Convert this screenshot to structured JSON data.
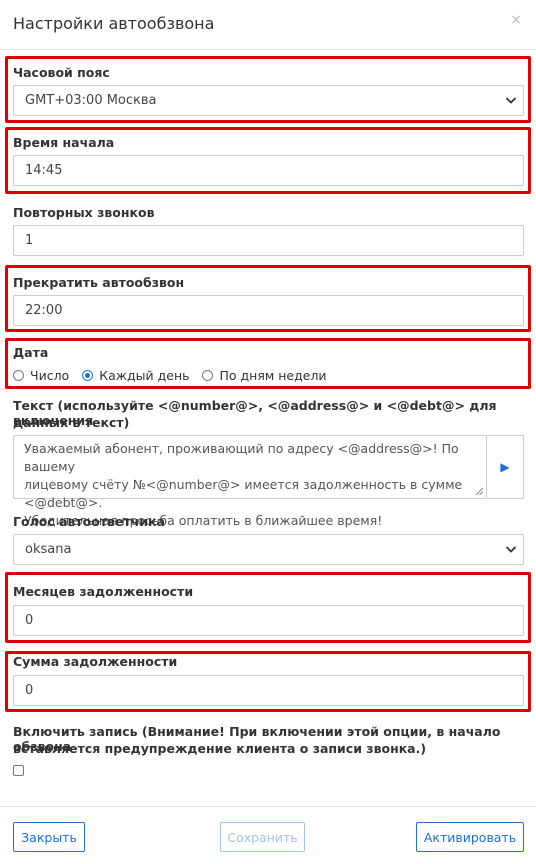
{
  "dialog": {
    "title": "Настройки автообзвона",
    "close": "×"
  },
  "timezone": {
    "label": "Часовой пояс",
    "value": "GMT+03:00 Москва"
  },
  "start_time": {
    "label": "Время начала",
    "value": "14:45"
  },
  "repeat_calls": {
    "label": "Повторных звонков",
    "value": "1"
  },
  "stop_time": {
    "label": "Прекратить автообзвон",
    "value": "22:00"
  },
  "date": {
    "label": "Дата",
    "options": [
      "Число",
      "Каждый день",
      "По дням недели"
    ],
    "selected": "Каждый день"
  },
  "text": {
    "label_line1": "Текст (используйте <@number@>, <@address@> и <@debt@> для включения",
    "label_line2": "данных в текст)",
    "value_line1": "Уважаемый абонент, проживающий по адресу <@address@>!  По вашему",
    "value_line2": "лицевому счёту №<@number@> имеется задолженность в сумме <@debt@>.",
    "value_line3": "Убедительная просьба оплатить в ближайшее время!",
    "play_icon": "play-icon"
  },
  "voice": {
    "label": "Голос автоответчика",
    "value": "oksana"
  },
  "months_debt": {
    "label": "Месяцев задолженности",
    "value": "0"
  },
  "debt_amount": {
    "label": "Сумма задолженности",
    "value": "0"
  },
  "recording": {
    "label_line1": "Включить запись (Внимание! При включении этой опции, в начало обзвона",
    "label_line2": "вставляется предупреждение клиента о записи звонка.)",
    "checked": false
  },
  "footer": {
    "close_label": "Закрыть",
    "save_label": "Сохранить",
    "activate_label": "Активировать"
  },
  "colors": {
    "accent": "#1e6fd9",
    "highlight": "#e00000"
  }
}
